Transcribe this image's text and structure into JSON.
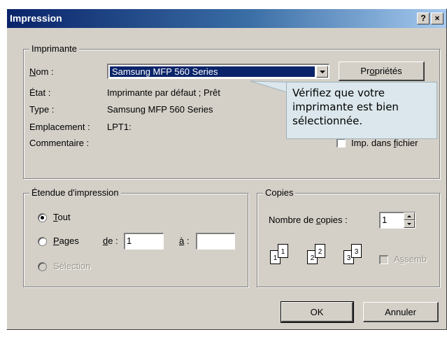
{
  "window": {
    "title": "Impression",
    "help_button": "?",
    "close_button": "×"
  },
  "printer_group": {
    "legend": "Imprimante",
    "name_label": "Nom :",
    "name_value": "Samsung MFP 560 Series",
    "properties_button": "Propriétés",
    "state_label": "État :",
    "state_value": "Imprimante par défaut ; Prêt",
    "type_label": "Type :",
    "type_value": "Samsung MFP 560 Series",
    "location_label": "Emplacement :",
    "location_value": "LPT1:",
    "comment_label": "Commentaire :",
    "print_to_file_label": "Imp. dans fichier"
  },
  "callout": {
    "lines": [
      "Vérifiez que votre",
      "imprimante est bien",
      "sélectionnée."
    ]
  },
  "range_group": {
    "legend": "Étendue d'impression",
    "all_label": "Tout",
    "pages_label": "Pages",
    "from_label": "de :",
    "from_value": "1",
    "to_label": "à :",
    "to_value": "",
    "selection_label": "Sélection"
  },
  "copies_group": {
    "legend": "Copies",
    "count_label": "Nombre de copies :",
    "count_value": "1",
    "collate_label": "Assemb",
    "collate_icons": [
      "1",
      "1",
      "2",
      "2",
      "3",
      "3"
    ]
  },
  "footer": {
    "ok_button": "OK",
    "cancel_button": "Annuler"
  },
  "colors": {
    "dialog_bg": "#d4d0c8",
    "title_bar_start": "#0a246a",
    "selection_bg": "#0a246a",
    "callout_bg": "#dbe7ec"
  }
}
